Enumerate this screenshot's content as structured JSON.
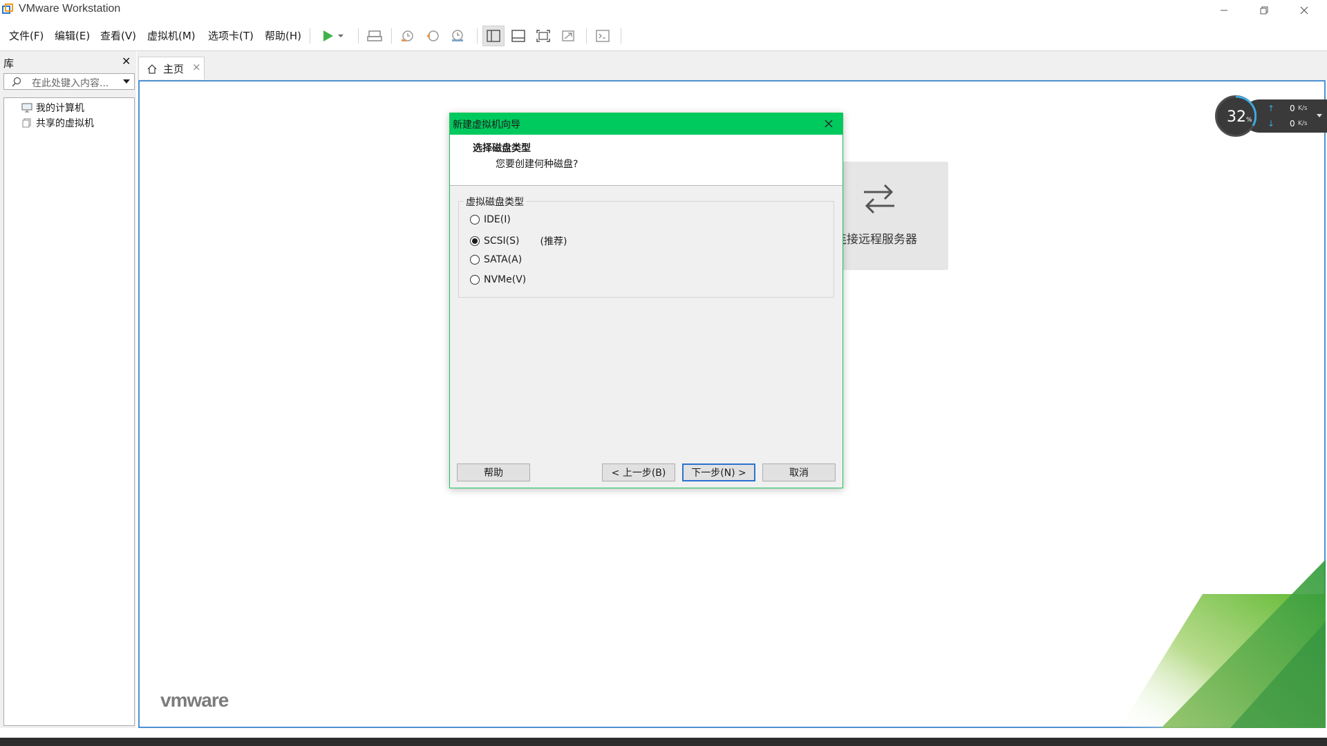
{
  "window": {
    "title": "VMware Workstation",
    "minimize_glyph": "—",
    "restore_glyph": "❐",
    "close_glyph": "✕"
  },
  "menu": [
    "文件(F)",
    "编辑(E)",
    "查看(V)",
    "虚拟机(M)",
    "选项卡(T)",
    "帮助(H)"
  ],
  "library": {
    "title": "库",
    "close_glyph": "✕",
    "search_placeholder": "在此处键入内容...",
    "items": [
      "我的计算机",
      "共享的虚拟机"
    ]
  },
  "tabs": [
    {
      "label": "主页",
      "close_glyph": "×"
    }
  ],
  "home": {
    "remote_server_label": "连接远程服务器",
    "logo_text": "vmware"
  },
  "net_widget": {
    "cpu_percent": "32",
    "percent_sign": "%",
    "upload": "0",
    "download": "0",
    "unit": "K/s"
  },
  "dialog": {
    "title": "新建虚拟机向导",
    "heading": "选择磁盘类型",
    "subheading": "您要创建何种磁盘?",
    "group_label": "虚拟磁盘类型",
    "options": [
      {
        "label": "IDE(I)",
        "selected": false
      },
      {
        "label": "SCSI(S)",
        "selected": true,
        "note": "(推荐)"
      },
      {
        "label": "SATA(A)",
        "selected": false
      },
      {
        "label": "NVMe(V)",
        "selected": false
      }
    ],
    "buttons": {
      "help": "帮助",
      "back": "< 上一步(B)",
      "next": "下一步(N) >",
      "cancel": "取消"
    }
  },
  "colors": {
    "dialog_titlebar": "#00c95d",
    "content_border": "#4c8fd0",
    "primary_button_border": "#2a72d0",
    "vmware_green": "#5fb832"
  }
}
